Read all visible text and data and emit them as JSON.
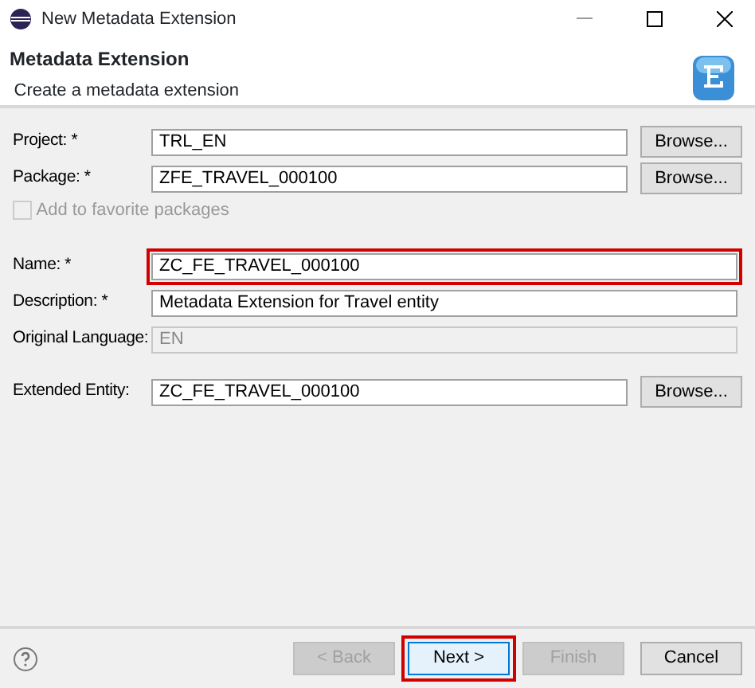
{
  "window": {
    "title": "New Metadata Extension"
  },
  "header": {
    "title": "Metadata Extension",
    "subtitle": "Create a metadata extension"
  },
  "fields": [
    {
      "label": "Project: *",
      "value": "TRL_EN",
      "disabled": false,
      "highlighted": false,
      "browse": "Browse..."
    },
    {
      "label": "Package: *",
      "value": "ZFE_TRAVEL_000100",
      "disabled": false,
      "highlighted": false,
      "browse": "Browse..."
    },
    {
      "label": "Name: *",
      "value": "ZC_FE_TRAVEL_000100",
      "disabled": false,
      "highlighted": true
    },
    {
      "label": "Description: *",
      "value": "Metadata Extension for Travel entity",
      "disabled": false,
      "highlighted": false
    },
    {
      "label": "Original Language:",
      "value": "EN",
      "disabled": true,
      "highlighted": false
    },
    {
      "label": "Extended Entity:",
      "value": "ZC_FE_TRAVEL_000100",
      "disabled": false,
      "highlighted": false,
      "browse": "Browse..."
    }
  ],
  "favorite": {
    "label": "Add to favorite packages",
    "checked": false,
    "disabled": true
  },
  "buttons": [
    {
      "label": "< Back",
      "disabled": true,
      "highlighted": false
    },
    {
      "label": "Next >",
      "disabled": false,
      "highlighted": true
    },
    {
      "label": "Finish",
      "disabled": true,
      "highlighted": false
    },
    {
      "label": "Cancel",
      "disabled": false,
      "highlighted": false
    }
  ]
}
